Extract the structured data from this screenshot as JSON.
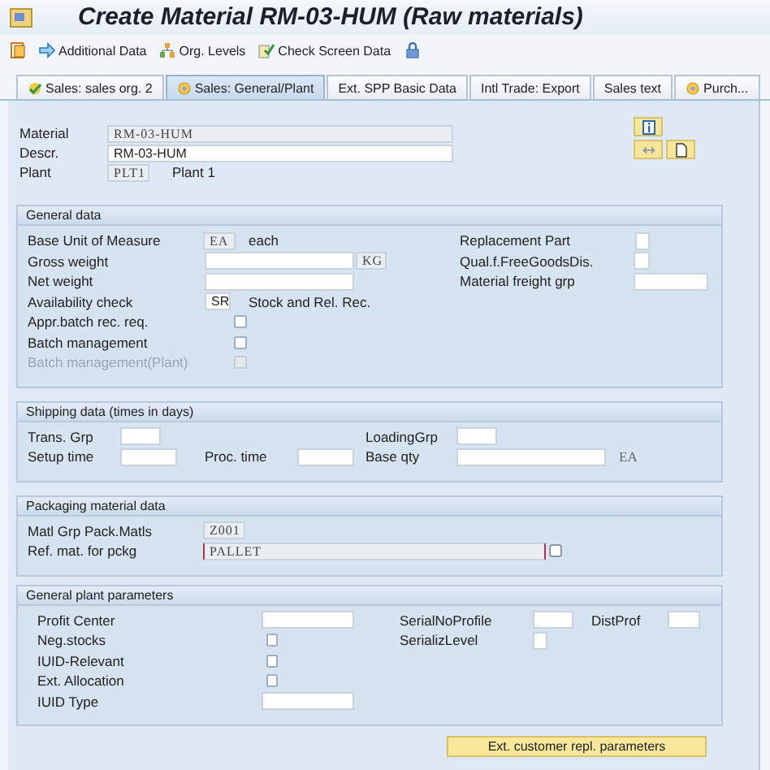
{
  "window": {
    "title": "Create Material RM-03-HUM (Raw materials)"
  },
  "toolbar": [
    {
      "kind": "document"
    },
    {
      "kind": "arrow",
      "label": "Additional Data"
    },
    {
      "kind": "org",
      "label": "Org. Levels"
    },
    {
      "kind": "check",
      "label": "Check Screen Data"
    },
    {
      "kind": "lock"
    }
  ],
  "tabs": [
    {
      "label": "Sales: sales org. 2",
      "selected": false,
      "kind": "done"
    },
    {
      "label": "Sales: General/Plant",
      "selected": true,
      "kind": "open"
    },
    {
      "label": "Ext. SPP Basic Data",
      "selected": false,
      "kind": "plain"
    },
    {
      "label": "Intl Trade: Export",
      "selected": false,
      "kind": "plain"
    },
    {
      "label": "Sales text",
      "selected": false,
      "kind": "plain"
    },
    {
      "label": "Purch...",
      "selected": false,
      "kind": "open"
    }
  ],
  "header": {
    "rows": [
      {
        "items": [
          {
            "kind": "label",
            "text": "Material"
          },
          {
            "kind": "field",
            "value": "RM-03-HUM",
            "readonly": true,
            "focused": false
          }
        ]
      },
      {
        "items": [
          {
            "kind": "label",
            "text": "Descr."
          },
          {
            "kind": "field",
            "value": "RM-03-HUM",
            "readonly": false,
            "focused": false
          }
        ]
      },
      {
        "items": [
          {
            "kind": "label",
            "text": "Plant"
          },
          {
            "kind": "field",
            "value": "PLT1",
            "readonly": true,
            "focused": false
          },
          {
            "kind": "text",
            "text": "Plant 1"
          }
        ]
      }
    ]
  },
  "sections": [
    {
      "title": "General data",
      "rows": [
        {
          "items": [
            {
              "kind": "label",
              "text": "Base Unit of Measure"
            },
            {
              "kind": "field",
              "value": "EA",
              "readonly": true,
              "focused": false
            },
            {
              "kind": "text",
              "text": "each"
            },
            {
              "kind": "label",
              "text": "Replacement Part"
            },
            {
              "kind": "field",
              "value": "",
              "readonly": false,
              "focused": false
            }
          ]
        },
        {
          "items": [
            {
              "kind": "label",
              "text": "Gross weight"
            },
            {
              "kind": "field",
              "value": "",
              "readonly": false,
              "focused": false
            },
            {
              "kind": "field",
              "value": "KG",
              "readonly": true,
              "focused": false
            },
            {
              "kind": "label",
              "text": "Qual.f.FreeGoodsDis."
            },
            {
              "kind": "field",
              "value": "",
              "readonly": false,
              "focused": false
            }
          ]
        },
        {
          "items": [
            {
              "kind": "label",
              "text": "Net weight"
            },
            {
              "kind": "field",
              "value": "",
              "readonly": false,
              "focused": false
            },
            {
              "kind": "label",
              "text": "Material freight grp"
            },
            {
              "kind": "field",
              "value": "",
              "readonly": false,
              "focused": false
            }
          ]
        },
        {
          "items": [
            {
              "kind": "label",
              "text": "Availability check"
            },
            {
              "kind": "field",
              "value": "SR",
              "readonly": false,
              "focused": false
            },
            {
              "kind": "text",
              "text": "Stock and Rel. Rec."
            }
          ]
        },
        {
          "items": [
            {
              "kind": "label",
              "text": "Appr.batch rec. req."
            },
            {
              "kind": "checkbox",
              "checked": false,
              "disabled": false
            }
          ]
        },
        {
          "items": [
            {
              "kind": "label",
              "text": "Batch management"
            },
            {
              "kind": "checkbox",
              "checked": false,
              "disabled": false
            }
          ]
        },
        {
          "items": [
            {
              "kind": "label",
              "text": "Batch management(Plant)"
            },
            {
              "kind": "checkbox",
              "checked": false,
              "disabled": true
            }
          ]
        }
      ]
    },
    {
      "title": "Shipping data (times in days)",
      "rows": [
        {
          "items": [
            {
              "kind": "label",
              "text": "Trans. Grp"
            },
            {
              "kind": "field",
              "value": "",
              "readonly": false,
              "focused": false
            },
            {
              "kind": "label",
              "text": "LoadingGrp"
            },
            {
              "kind": "field",
              "value": "",
              "readonly": false,
              "focused": false
            }
          ]
        },
        {
          "items": [
            {
              "kind": "label",
              "text": "Setup time"
            },
            {
              "kind": "field",
              "value": "",
              "readonly": false,
              "focused": false
            },
            {
              "kind": "label",
              "text": "Proc. time"
            },
            {
              "kind": "field",
              "value": "",
              "readonly": false,
              "focused": false
            },
            {
              "kind": "label",
              "text": "Base qty"
            },
            {
              "kind": "field",
              "value": "",
              "readonly": false,
              "focused": false
            },
            {
              "kind": "unit",
              "text": "EA"
            }
          ]
        }
      ]
    },
    {
      "title": "Packaging material data",
      "rows": [
        {
          "items": [
            {
              "kind": "label",
              "text": "Matl Grp Pack.Matls"
            },
            {
              "kind": "field",
              "value": "Z001",
              "readonly": true,
              "focused": false
            }
          ]
        },
        {
          "items": [
            {
              "kind": "label",
              "text": "Ref. mat. for pckg"
            },
            {
              "kind": "field",
              "value": "PALLET",
              "readonly": true,
              "focused": true
            },
            {
              "kind": "help"
            }
          ]
        }
      ]
    },
    {
      "title": "General plant parameters",
      "rows": [
        {
          "items": [
            {
              "kind": "label",
              "text": "Profit Center"
            },
            {
              "kind": "field",
              "value": "",
              "readonly": false,
              "focused": false
            },
            {
              "kind": "label",
              "text": "SerialNoProfile"
            },
            {
              "kind": "field",
              "value": "",
              "readonly": false,
              "focused": false
            },
            {
              "kind": "label",
              "text": "DistProf"
            },
            {
              "kind": "field",
              "value": "",
              "readonly": false,
              "focused": false
            }
          ]
        },
        {
          "items": [
            {
              "kind": "label",
              "text": "Neg.stocks"
            },
            {
              "kind": "checkbox",
              "checked": false,
              "disabled": false
            },
            {
              "kind": "label",
              "text": "SerializLevel"
            },
            {
              "kind": "field",
              "value": "",
              "readonly": false,
              "focused": false
            }
          ]
        },
        {
          "items": [
            {
              "kind": "label",
              "text": "IUID-Relevant"
            },
            {
              "kind": "checkbox",
              "checked": false,
              "disabled": false
            }
          ]
        },
        {
          "items": [
            {
              "kind": "label",
              "text": "Ext. Allocation"
            },
            {
              "kind": "checkbox",
              "checked": false,
              "disabled": false
            }
          ]
        },
        {
          "items": [
            {
              "kind": "label",
              "text": "IUID Type"
            },
            {
              "kind": "field",
              "value": "",
              "readonly": false,
              "focused": false
            }
          ]
        }
      ]
    }
  ],
  "footer_button": {
    "label": "Ext. customer repl. parameters"
  }
}
